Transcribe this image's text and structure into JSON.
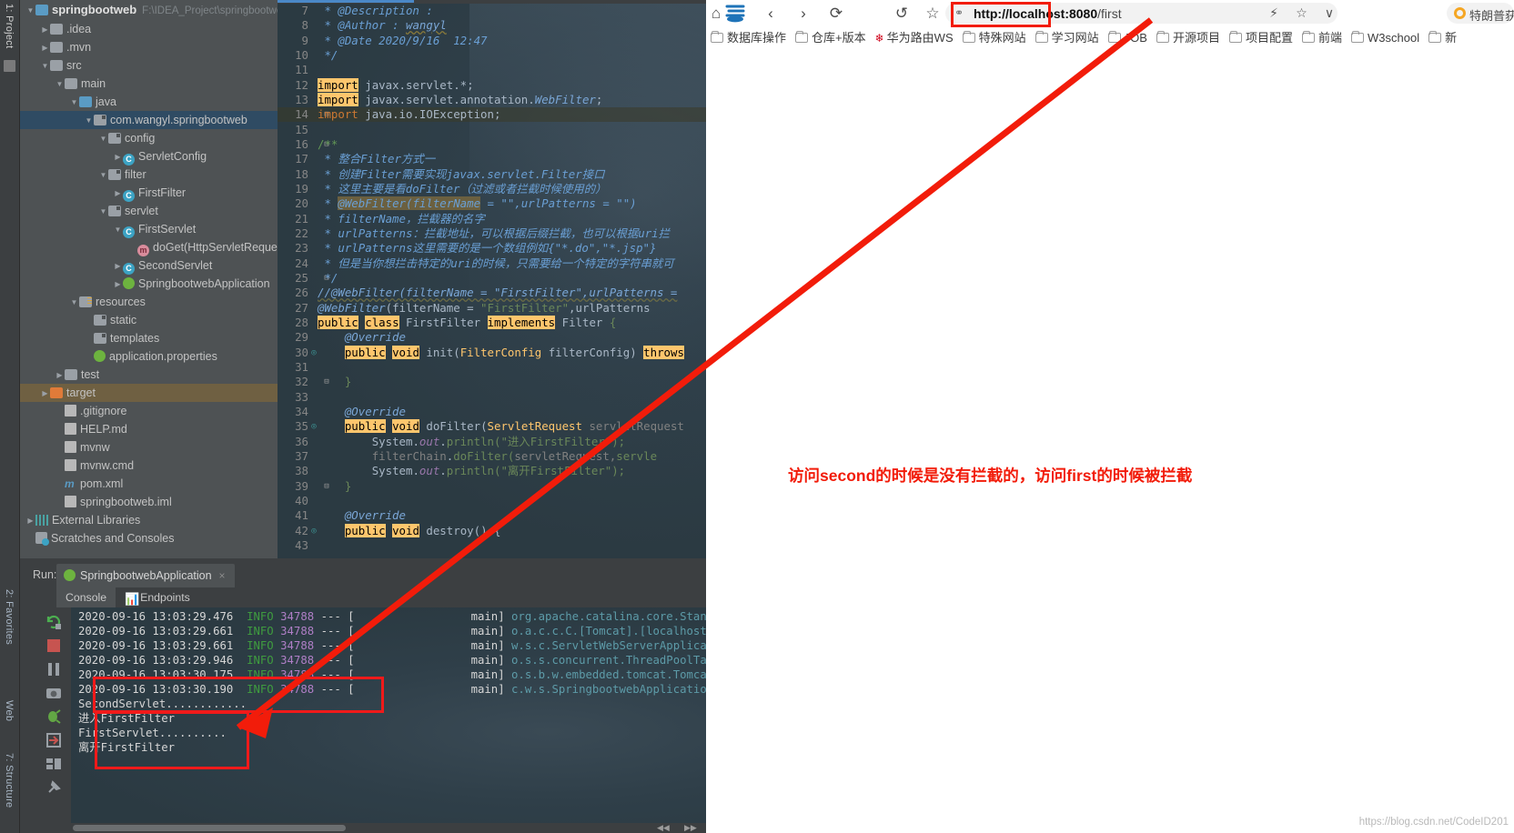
{
  "ide": {
    "left_strip": {
      "project_label": "1: Project",
      "favorites_label": "2: Favorites",
      "web_label": "Web",
      "structure_label": "7: Structure"
    },
    "project_tree": {
      "root_label": "springbootweb",
      "root_path": "F:\\IDEA_Project\\springbootweb",
      "items": [
        {
          "label": ".idea",
          "indent": 1,
          "arrow": "▶",
          "icon": "folder"
        },
        {
          "label": ".mvn",
          "indent": 1,
          "arrow": "▶",
          "icon": "folder"
        },
        {
          "label": "src",
          "indent": 1,
          "arrow": "▼",
          "icon": "folder"
        },
        {
          "label": "main",
          "indent": 2,
          "arrow": "▼",
          "icon": "folder"
        },
        {
          "label": "java",
          "indent": 3,
          "arrow": "▼",
          "icon": "folder-blue"
        },
        {
          "label": "com.wangyl.springbootweb",
          "indent": 4,
          "arrow": "▼",
          "icon": "package",
          "selected": true
        },
        {
          "label": "config",
          "indent": 5,
          "arrow": "▼",
          "icon": "package"
        },
        {
          "label": "ServletConfig",
          "indent": 6,
          "arrow": "▶",
          "icon": "class"
        },
        {
          "label": "filter",
          "indent": 5,
          "arrow": "▼",
          "icon": "package"
        },
        {
          "label": "FirstFilter",
          "indent": 6,
          "arrow": "▶",
          "icon": "class"
        },
        {
          "label": "servlet",
          "indent": 5,
          "arrow": "▼",
          "icon": "package"
        },
        {
          "label": "FirstServlet",
          "indent": 6,
          "arrow": "▼",
          "icon": "class"
        },
        {
          "label": "doGet(HttpServletReque",
          "indent": 7,
          "arrow": "",
          "icon": "method"
        },
        {
          "label": "SecondServlet",
          "indent": 6,
          "arrow": "▶",
          "icon": "class"
        },
        {
          "label": "SpringbootwebApplication",
          "indent": 6,
          "arrow": "▶",
          "icon": "spring"
        },
        {
          "label": "resources",
          "indent": 3,
          "arrow": "▼",
          "icon": "resources"
        },
        {
          "label": "static",
          "indent": 4,
          "arrow": "",
          "icon": "package"
        },
        {
          "label": "templates",
          "indent": 4,
          "arrow": "",
          "icon": "package"
        },
        {
          "label": "application.properties",
          "indent": 4,
          "arrow": "",
          "icon": "spring"
        },
        {
          "label": "test",
          "indent": 2,
          "arrow": "▶",
          "icon": "folder"
        },
        {
          "label": "target",
          "indent": 1,
          "arrow": "▶",
          "icon": "folder-orange",
          "target": true
        },
        {
          "label": ".gitignore",
          "indent": 2,
          "arrow": "",
          "icon": "file"
        },
        {
          "label": "HELP.md",
          "indent": 2,
          "arrow": "",
          "icon": "file-md"
        },
        {
          "label": "mvnw",
          "indent": 2,
          "arrow": "",
          "icon": "file"
        },
        {
          "label": "mvnw.cmd",
          "indent": 2,
          "arrow": "",
          "icon": "file"
        },
        {
          "label": "pom.xml",
          "indent": 2,
          "arrow": "",
          "icon": "maven"
        },
        {
          "label": "springbootweb.iml",
          "indent": 2,
          "arrow": "",
          "icon": "file"
        },
        {
          "label": "External Libraries",
          "indent": 0,
          "arrow": "▶",
          "icon": "ext-lib"
        },
        {
          "label": "Scratches and Consoles",
          "indent": 0,
          "arrow": "",
          "icon": "scratches"
        }
      ]
    },
    "editor": {
      "first_line_number": 7,
      "lines": [
        {
          "n": 7,
          "html": "<span class='jdoc'> * @Description :</span>"
        },
        {
          "n": 8,
          "html": "<span class='jdoc'> * @Author : </span><span class='jdoc2' style='text-decoration:underline wavy #8a7a3a'>wangyl</span>"
        },
        {
          "n": 9,
          "html": "<span class='jdoc'> * @Date 2020/9/16  12:47</span>"
        },
        {
          "n": 10,
          "html": "<span class='jdoc'> */</span>"
        },
        {
          "n": 11,
          "html": ""
        },
        {
          "n": 12,
          "html": "<span class='kw'>import</span> <span class='id'>javax.servlet.*;</span>",
          "fold": true
        },
        {
          "n": 13,
          "html": "<span class='kw'>import</span> <span class='id'>javax.servlet.annotation.</span><span class='jdoc2'>WebFilter</span><span class='id'>;</span>"
        },
        {
          "n": 14,
          "html": "<span class='kwr'>import</span> <span class='id'>java.io.IOException;</span>",
          "caret": true,
          "fold": true
        },
        {
          "n": 15,
          "html": ""
        },
        {
          "n": 16,
          "html": "<span class='cmt'>/**</span>",
          "fold": true
        },
        {
          "n": 17,
          "html": "<span class='jdoc'> * 整合Filter方式一</span>"
        },
        {
          "n": 18,
          "html": "<span class='jdoc'> * 创建Filter需要实现javax.servlet.Filter接口</span>"
        },
        {
          "n": 19,
          "html": "<span class='jdoc'> * 这里主要是看doFilter（过滤或者拦截时候使用的）</span>"
        },
        {
          "n": 20,
          "html": "<span class='jdoc'> * </span><span class='jdoc' style='background:#6b6040'>@WebFilter(filterName</span><span class='jdoc'> = \"\",urlPatterns = \"\")</span>"
        },
        {
          "n": 21,
          "html": "<span class='jdoc'> * filterName，拦截器的名字</span>"
        },
        {
          "n": 22,
          "html": "<span class='jdoc'> * urlPatterns：拦截地址，可以根据后缀拦截，也可以根据uri拦</span>"
        },
        {
          "n": 23,
          "html": "<span class='jdoc'> * urlPatterns这里需要的是一个数组例如{\"*.do\",\"*.jsp\"}</span>"
        },
        {
          "n": 24,
          "html": "<span class='jdoc'> * 但是当你想拦击特定的uri的时候，只需要给一个特定的字符串就可</span>"
        },
        {
          "n": 25,
          "html": "<span class='jdoc'> */</span>",
          "fold": true
        },
        {
          "n": 26,
          "html": "<span class='jdoc2' style='text-decoration:underline wavy #6b6b45'>//@WebFilter(filterName = \"FirstFilter\",urlPatterns =</span>"
        },
        {
          "n": 27,
          "html": "<span class='jdoc2'>@WebFilter</span><span class='id'>(filterName = </span><span class='str'>\"FirstFilter\"</span><span class='id'>,urlPatterns</span>"
        },
        {
          "n": 28,
          "html": "<span class='kw'>public</span> <span class='kw'>class</span> <span class='id'>FirstFilter</span> <span class='kw'>implements</span> <span class='id'>Filter</span> <span class='str'>{</span>"
        },
        {
          "n": 29,
          "html": "    <span class='jdoc2'>@Override</span>"
        },
        {
          "n": 30,
          "html": "    <span class='kw'>public</span> <span class='kw'>void</span> <span class='id'>init(</span><span class='fn'>FilterConfig</span> <span class='id'>filterConfig)</span> <span class='kw'>throws</span>",
          "gutter": "o"
        },
        {
          "n": 31,
          "html": ""
        },
        {
          "n": 32,
          "html": "    <span class='str'>}</span>",
          "fold": true
        },
        {
          "n": 33,
          "html": ""
        },
        {
          "n": 34,
          "html": "    <span class='jdoc2'>@Override</span>"
        },
        {
          "n": 35,
          "html": "    <span class='kw'>public</span> <span class='kw'>void</span> <span class='id'>doFilter(</span><span class='fn'>ServletRequest</span> <span class='gy'>servletRequest</span>",
          "gutter": "o"
        },
        {
          "n": 36,
          "html": "        <span class='id'>System.</span><span class='fld'>out</span><span class='id'>.</span><span class='str'>println(</span><span class='str'>\"进入FirstFilter\"</span><span class='str'>);</span>"
        },
        {
          "n": 37,
          "html": "        <span class='gy'>filterChain</span><span class='id'>.</span><span class='str'>doFilter(</span><span class='gy'>servletRequest,</span><span class='str'>servle</span>"
        },
        {
          "n": 38,
          "html": "        <span class='id'>System.</span><span class='fld'>out</span><span class='id'>.</span><span class='str'>println(</span><span class='str'>\"离开FirstFilter\"</span><span class='str'>);</span>"
        },
        {
          "n": 39,
          "html": "    <span class='str'>}</span>",
          "fold": true
        },
        {
          "n": 40,
          "html": ""
        },
        {
          "n": 41,
          "html": "    <span class='jdoc2'>@Override</span>"
        },
        {
          "n": 42,
          "html": "    <span class='kw'>public</span> <span class='kw'>void</span> <span class='id'>destroy() {</span>",
          "gutter": "o"
        },
        {
          "n": 43,
          "html": ""
        }
      ]
    },
    "run_panel": {
      "run_label": "Run:",
      "config_name": "SpringbootwebApplication",
      "close_glyph": "×",
      "tabs": [
        {
          "label": "Console",
          "active": true
        },
        {
          "label": "Endpoints",
          "active": false
        }
      ],
      "console_lines": [
        {
          "ts": "2020-09-16 13:03:29.476",
          "level": "INFO",
          "pid": "34788",
          "dash": "--- [",
          "thread": "main]",
          "cls": "org.apache.catalina.core.StandardS"
        },
        {
          "ts": "2020-09-16 13:03:29.661",
          "level": "INFO",
          "pid": "34788",
          "dash": "--- [",
          "thread": "main]",
          "cls": "o.a.c.c.C.[Tomcat].[localhost].[/"
        },
        {
          "ts": "2020-09-16 13:03:29.661",
          "level": "INFO",
          "pid": "34788",
          "dash": "--- [",
          "thread": "main]",
          "cls": "w.s.c.ServletWebServerApplication"
        },
        {
          "ts": "2020-09-16 13:03:29.946",
          "level": "INFO",
          "pid": "34788",
          "dash": "--- [",
          "thread": "main]",
          "cls": "o.s.s.concurrent.ThreadPoolTaskExe"
        },
        {
          "ts": "2020-09-16 13:03:30.175",
          "level": "INFO",
          "pid": "34788",
          "dash": "--- [",
          "thread": "main]",
          "cls": "o.s.b.w.embedded.tomcat.TomcatWebS"
        },
        {
          "ts": "2020-09-16 13:03:30.190",
          "level": "INFO",
          "pid": "34788",
          "dash": "--- [",
          "thread": "main]",
          "cls": "c.w.s.SpringbootwebApplication"
        }
      ],
      "plain_lines": [
        "SecondServlet............",
        "进入FirstFilter",
        "FirstServlet..........",
        "离开FirstFilter"
      ]
    }
  },
  "browser": {
    "url_domain": "http://localhost:8080",
    "url_path": "/first",
    "nav": {
      "back": "‹",
      "forward": "›",
      "reload": "⟳",
      "home": "⌂",
      "history": "↺",
      "favorite": "☆"
    },
    "toolbar_right": {
      "flash": "⚡",
      "star": "☆",
      "chevron": "∨"
    },
    "news_pill": "特朗普获得",
    "bookmarks": [
      "数据库操作",
      "仓库+版本",
      "华为路由WS",
      "特殊网站",
      "学习网站",
      "JOB",
      "开源项目",
      "项目配置",
      "前端",
      "W3school",
      "新"
    ],
    "annotation": "访问second的时候是没有拦截的，访问first的时候被拦截",
    "watermark": "https://blog.csdn.net/CodeID201"
  }
}
